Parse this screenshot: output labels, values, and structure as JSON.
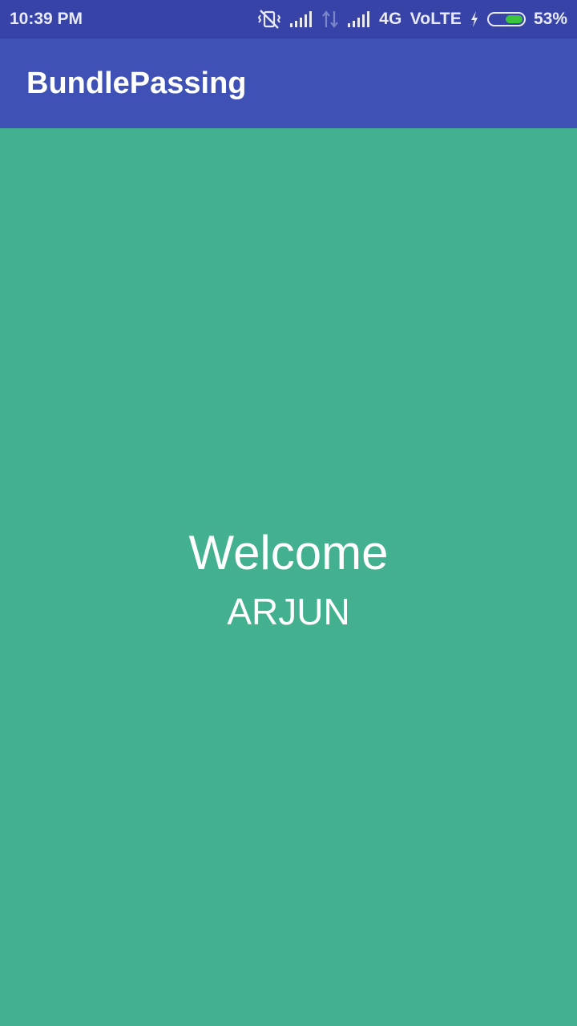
{
  "status_bar": {
    "time": "10:39 PM",
    "network": "4G",
    "volte": "VoLTE",
    "battery_percent_text": "53%",
    "battery_level": 0.53,
    "icons": [
      "vibrate-off-icon",
      "signal-icon",
      "data-activity-icon",
      "signal-icon",
      "charging-icon",
      "battery-icon"
    ]
  },
  "app_bar": {
    "title": "BundlePassing"
  },
  "content": {
    "welcome_text": "Welcome",
    "name_text": "ARJUN"
  },
  "colors": {
    "status_bar": "#3843a8",
    "app_bar": "#3f51b5",
    "background": "#43b08f",
    "battery_fill": "#3dc43d"
  }
}
